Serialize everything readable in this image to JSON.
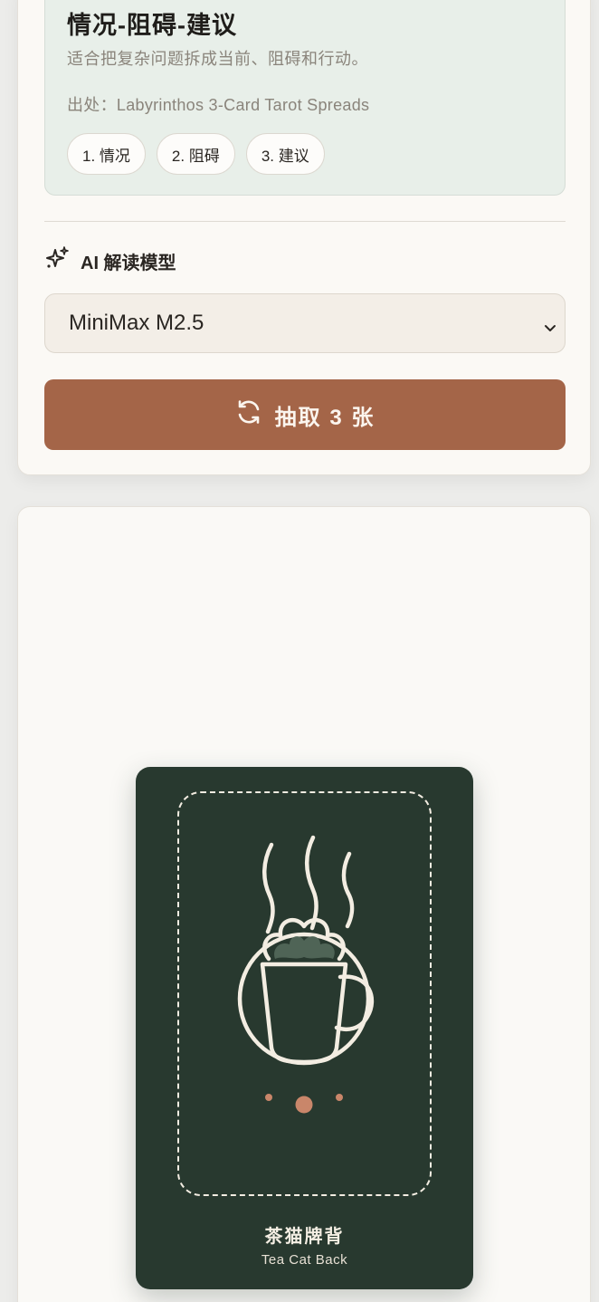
{
  "spread": {
    "title": "情况-阻碍-建议",
    "description": "适合把复杂问题拆成当前、阻碍和行动。",
    "source": "出处：Labyrinthos 3-Card Tarot Spreads",
    "positions": [
      "1. 情况",
      "2. 阻碍",
      "3. 建议"
    ]
  },
  "model": {
    "label": "AI 解读模型",
    "icon": "sparkles-icon",
    "selected": "MiniMax M2.5"
  },
  "draw_button": {
    "label": "抽取 3 张",
    "icon": "refresh-icon"
  },
  "card_back": {
    "title": "茶猫牌背",
    "subtitle": "Tea Cat Back",
    "icon": "tea-cup-icon"
  },
  "colors": {
    "accent": "#a46548",
    "card_back": "#28392f",
    "spread_bg": "#e8efe9"
  }
}
